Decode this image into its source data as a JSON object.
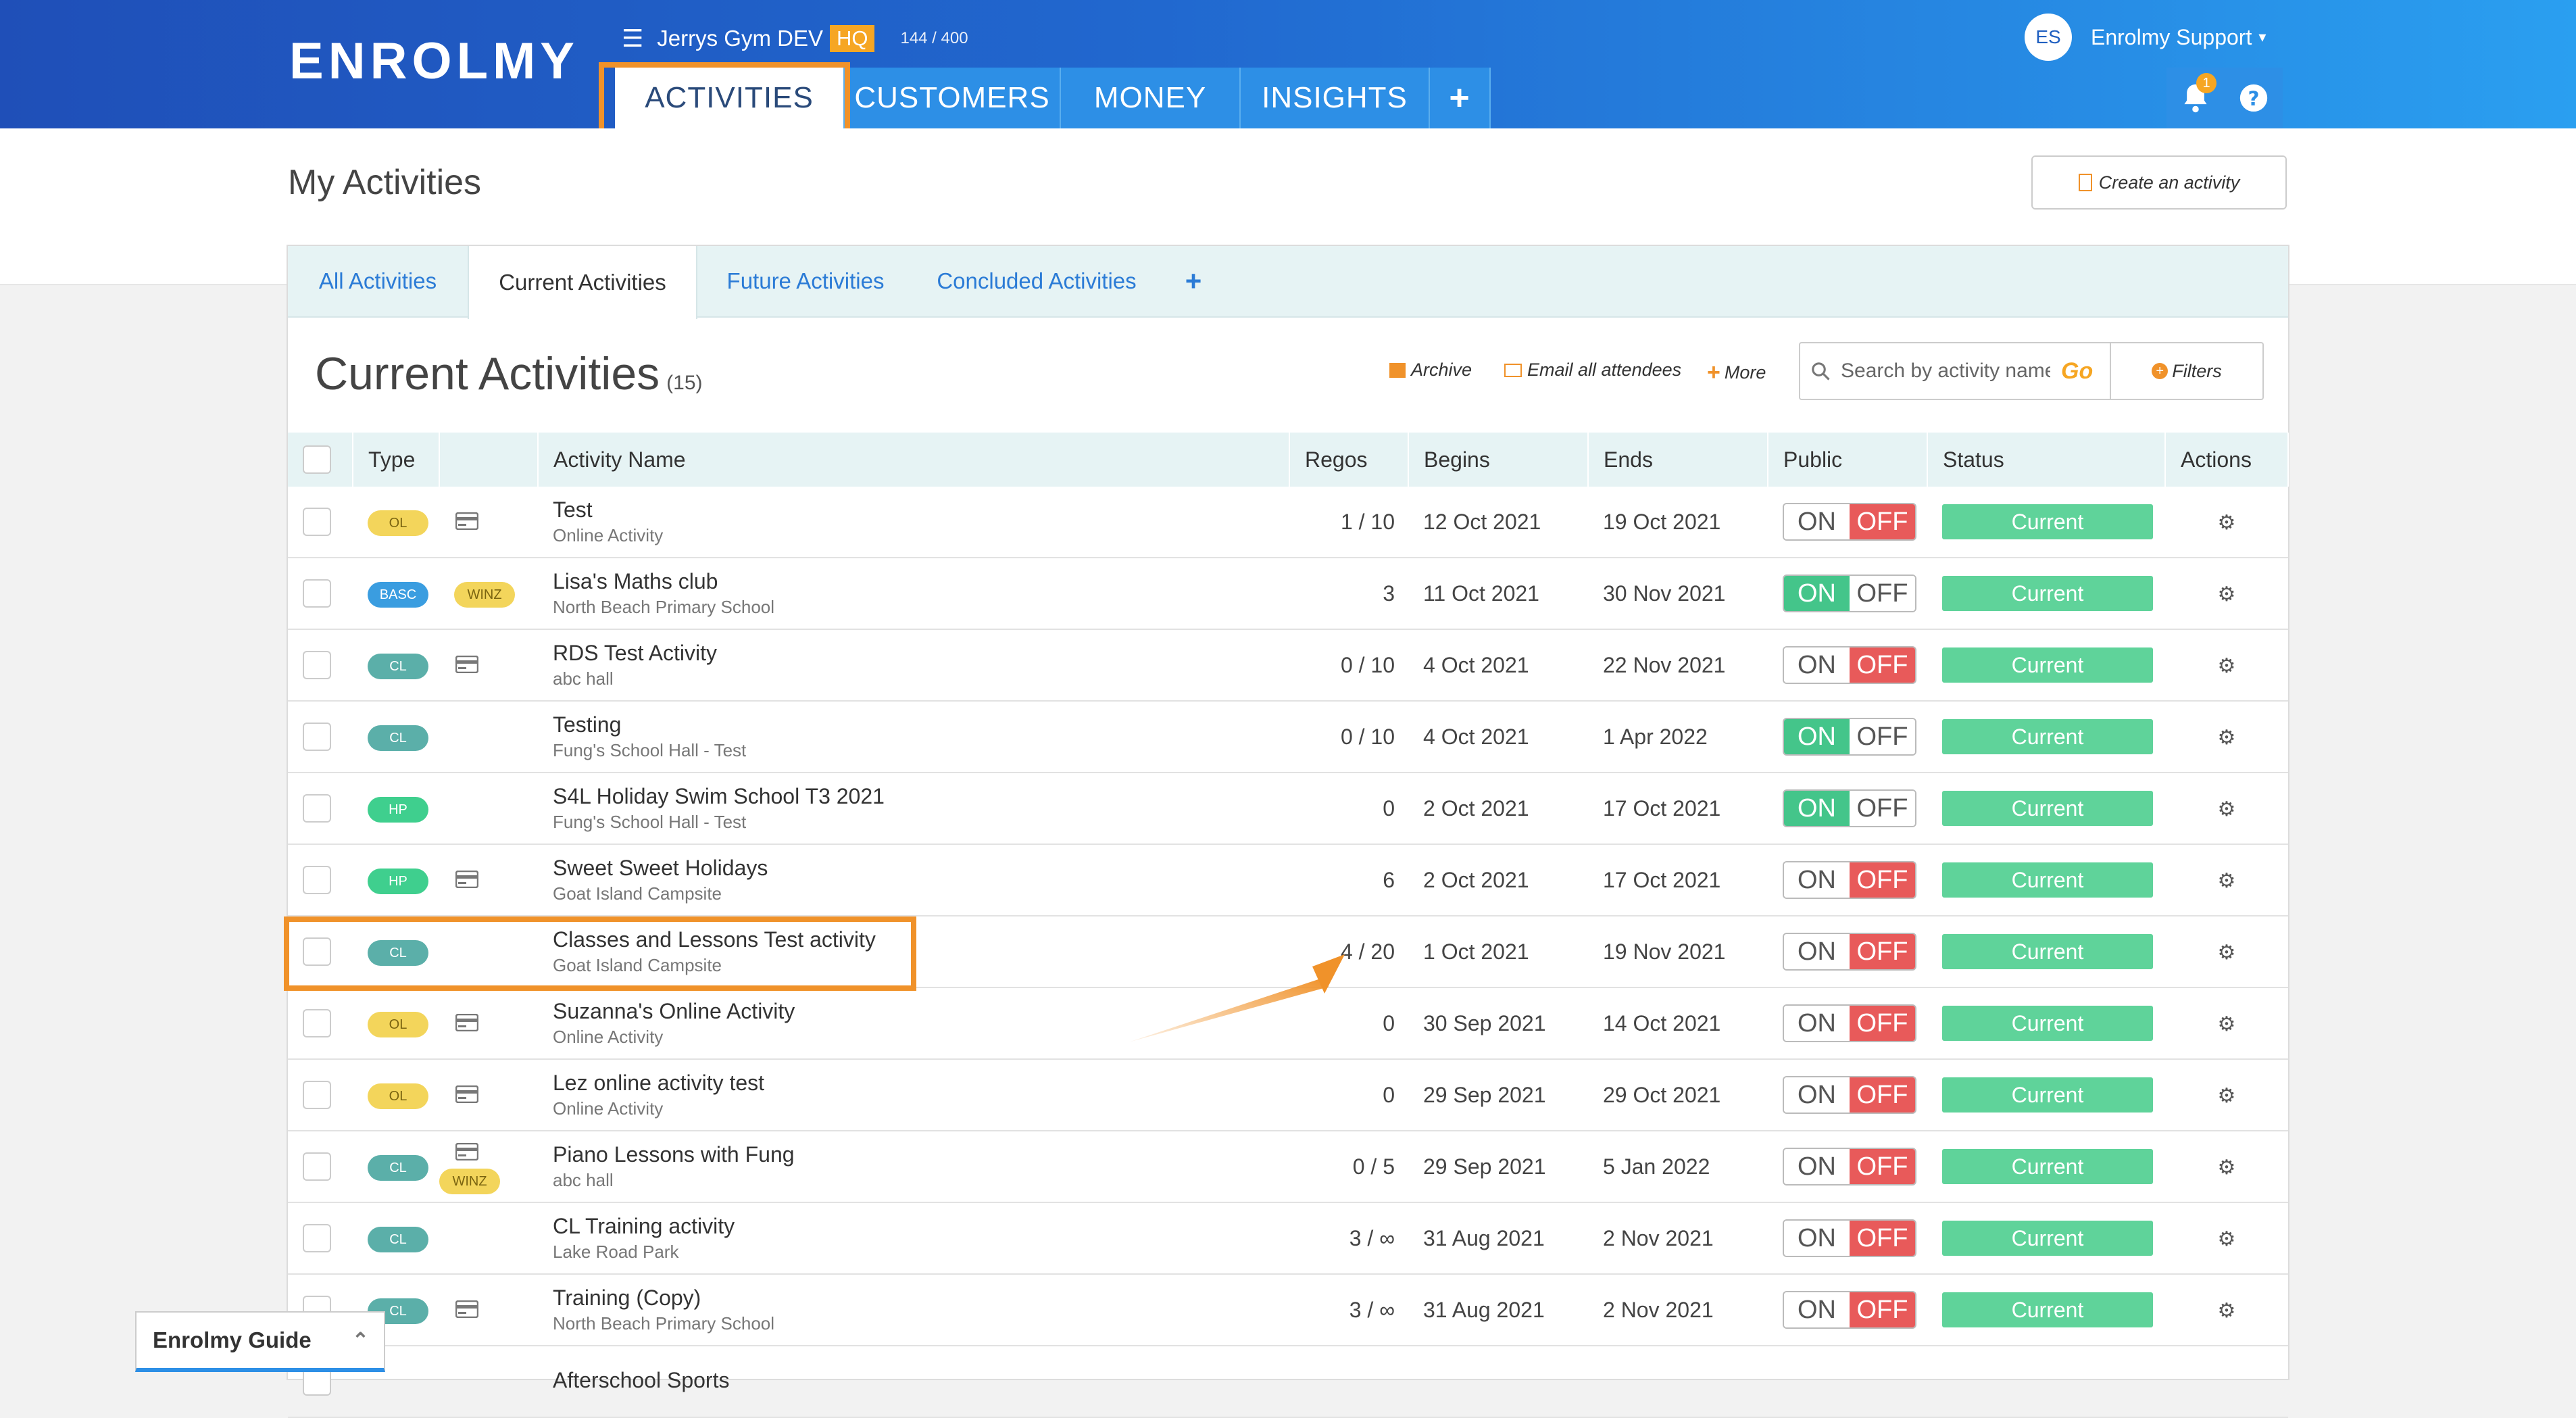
{
  "app": {
    "logo": "ENROLMY",
    "org_name": "Jerrys Gym DEV",
    "org_badge": "HQ",
    "usage": "144 / 400"
  },
  "nav": {
    "tabs": [
      "ACTIVITIES",
      "CUSTOMERS",
      "MONEY",
      "INSIGHTS"
    ]
  },
  "user": {
    "initials": "ES",
    "name": "Enrolmy Support",
    "notifications": "1"
  },
  "page": {
    "title": "My Activities",
    "create_label": "Create an activity"
  },
  "tabs": [
    "All Activities",
    "Current Activities",
    "Future Activities",
    "Concluded Activities"
  ],
  "list": {
    "title": "Current Activities",
    "count": "(15)",
    "archive": "Archive",
    "email": "Email all attendees",
    "more": "More",
    "search_placeholder": "Search by activity name",
    "go": "Go",
    "filters": "Filters"
  },
  "columns": [
    "Type",
    "Activity Name",
    "Regos",
    "Begins",
    "Ends",
    "Public",
    "Status",
    "Actions"
  ],
  "rows": [
    {
      "type": "OL",
      "card": true,
      "tag": "",
      "name": "Test",
      "venue": "Online Activity",
      "regos": "1 / 10",
      "begins": "12 Oct 2021",
      "ends": "19 Oct 2021",
      "public": "OFF",
      "status": "Current"
    },
    {
      "type": "BASC",
      "card": false,
      "tag": "WINZ",
      "name": "Lisa's Maths club",
      "venue": "North Beach Primary School",
      "regos": "3",
      "begins": "11 Oct 2021",
      "ends": "30 Nov 2021",
      "public": "ON",
      "status": "Current"
    },
    {
      "type": "CL",
      "card": true,
      "tag": "",
      "name": "RDS Test Activity",
      "venue": "abc hall",
      "regos": "0 / 10",
      "begins": "4 Oct 2021",
      "ends": "22 Nov 2021",
      "public": "OFF",
      "status": "Current"
    },
    {
      "type": "CL",
      "card": false,
      "tag": "",
      "name": "Testing",
      "venue": "Fung's School Hall - Test",
      "regos": "0 / 10",
      "begins": "4 Oct 2021",
      "ends": "1 Apr 2022",
      "public": "ON",
      "status": "Current"
    },
    {
      "type": "HP",
      "card": false,
      "tag": "",
      "name": "S4L Holiday Swim School T3 2021",
      "venue": "Fung's School Hall - Test",
      "regos": "0",
      "begins": "2 Oct 2021",
      "ends": "17 Oct 2021",
      "public": "ON",
      "status": "Current"
    },
    {
      "type": "HP",
      "card": true,
      "tag": "",
      "name": "Sweet Sweet Holidays",
      "venue": "Goat Island Campsite",
      "regos": "6",
      "begins": "2 Oct 2021",
      "ends": "17 Oct 2021",
      "public": "OFF",
      "status": "Current"
    },
    {
      "type": "CL",
      "card": false,
      "tag": "",
      "name": "Classes and Lessons Test activity",
      "venue": "Goat Island Campsite",
      "regos": "4 / 20",
      "begins": "1 Oct 2021",
      "ends": "19 Nov 2021",
      "public": "OFF",
      "status": "Current"
    },
    {
      "type": "OL",
      "card": true,
      "tag": "",
      "name": "Suzanna's Online Activity",
      "venue": "Online Activity",
      "regos": "0",
      "begins": "30 Sep 2021",
      "ends": "14 Oct 2021",
      "public": "OFF",
      "status": "Current"
    },
    {
      "type": "OL",
      "card": true,
      "tag": "",
      "name": "Lez online activity test",
      "venue": "Online Activity",
      "regos": "0",
      "begins": "29 Sep 2021",
      "ends": "29 Oct 2021",
      "public": "OFF",
      "status": "Current"
    },
    {
      "type": "CL",
      "card": true,
      "tag": "WINZ",
      "name": "Piano Lessons with Fung",
      "venue": "abc hall",
      "regos": "0 / 5",
      "begins": "29 Sep 2021",
      "ends": "5 Jan 2022",
      "public": "OFF",
      "status": "Current"
    },
    {
      "type": "CL",
      "card": false,
      "tag": "",
      "name": "CL Training activity",
      "venue": "Lake Road Park",
      "regos": "3 / ∞",
      "begins": "31 Aug 2021",
      "ends": "2 Nov 2021",
      "public": "OFF",
      "status": "Current"
    },
    {
      "type": "CL",
      "card": true,
      "tag": "",
      "name": "Training (Copy)",
      "venue": "North Beach Primary School",
      "regos": "3 / ∞",
      "begins": "31 Aug 2021",
      "ends": "2 Nov 2021",
      "public": "OFF",
      "status": "Current"
    },
    {
      "type": "",
      "card": false,
      "tag": "",
      "name": "Afterschool Sports",
      "venue": "",
      "regos": "",
      "begins": "",
      "ends": "",
      "public": "",
      "status": ""
    }
  ],
  "toggle": {
    "on": "ON",
    "off": "OFF"
  },
  "guide": {
    "label": "Enrolmy Guide"
  }
}
